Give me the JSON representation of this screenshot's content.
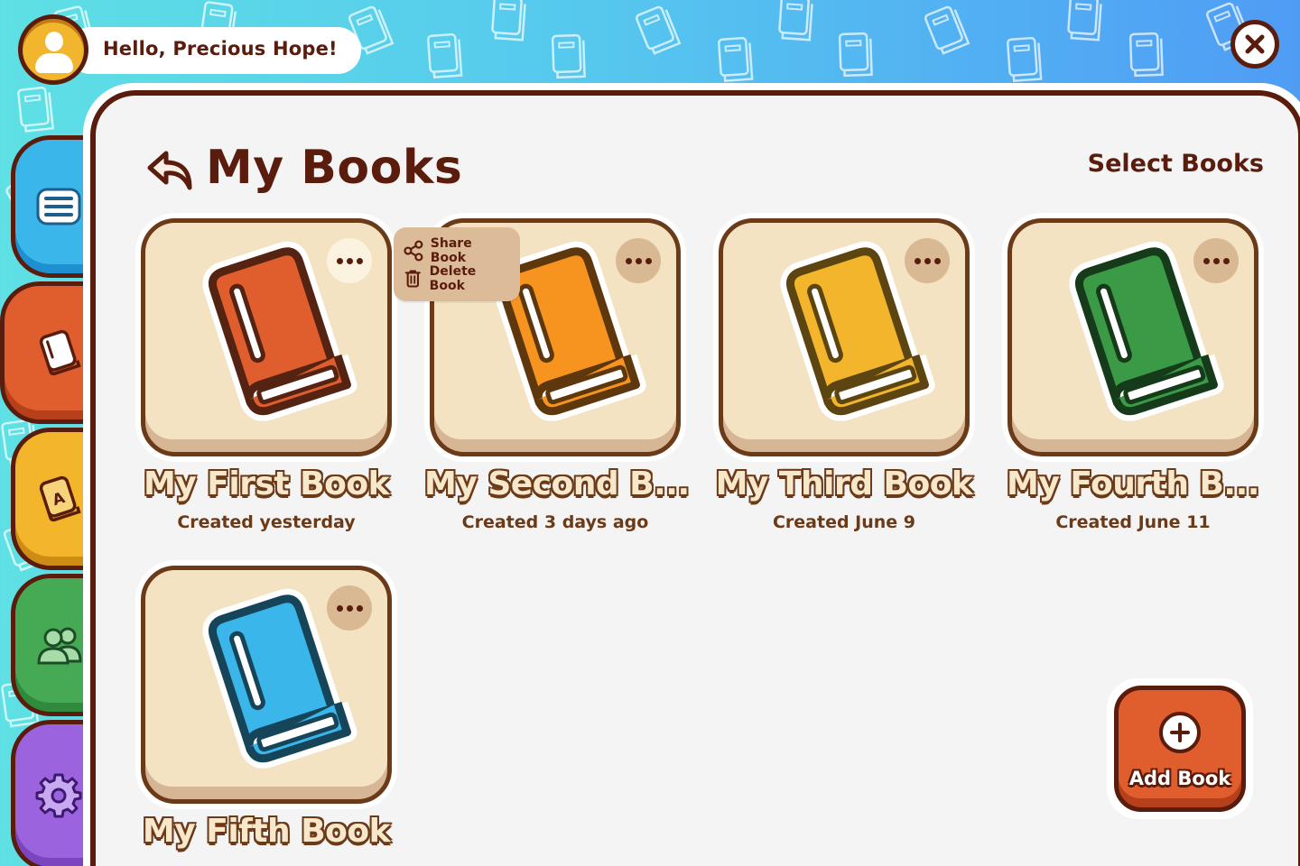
{
  "header": {
    "greeting": "Hello, Precious Hope!",
    "avatar_icon": "user-icon",
    "close_icon": "close-icon"
  },
  "sidebar": {
    "items": [
      {
        "name": "menu",
        "icon": "menu-icon",
        "color": "#3bb6ea"
      },
      {
        "name": "books",
        "icon": "book-icon",
        "color": "#e05d2e",
        "active": true
      },
      {
        "name": "words",
        "icon": "letter-book-icon",
        "color": "#f2b52b"
      },
      {
        "name": "friends",
        "icon": "people-icon",
        "color": "#46a954"
      },
      {
        "name": "settings",
        "icon": "gear-icon",
        "color": "#9c63de"
      }
    ]
  },
  "main": {
    "title": "My Books",
    "back_icon": "back-arrow-icon",
    "select_label": "Select Books"
  },
  "books": [
    {
      "title": "My First Book",
      "subtitle": "Created yesterday",
      "color": "#e05d2e"
    },
    {
      "title": "My Second B...",
      "subtitle": "Created 3 days ago",
      "color": "#f7941f"
    },
    {
      "title": "My Third Book",
      "subtitle": "Created June 9",
      "color": "#f2b52b"
    },
    {
      "title": "My Fourth B...",
      "subtitle": "Created June 11",
      "color": "#3a9a45"
    },
    {
      "title": "My Fifth Book",
      "subtitle": "",
      "color": "#3bb6ea"
    }
  ],
  "context_menu": {
    "share_label": "Share Book",
    "delete_label": "Delete Book"
  },
  "add_button": {
    "label": "Add Book"
  },
  "colors": {
    "outline": "#5a1c0c",
    "card_face": "#f4e3c2",
    "panel": "#f4f4f4"
  }
}
